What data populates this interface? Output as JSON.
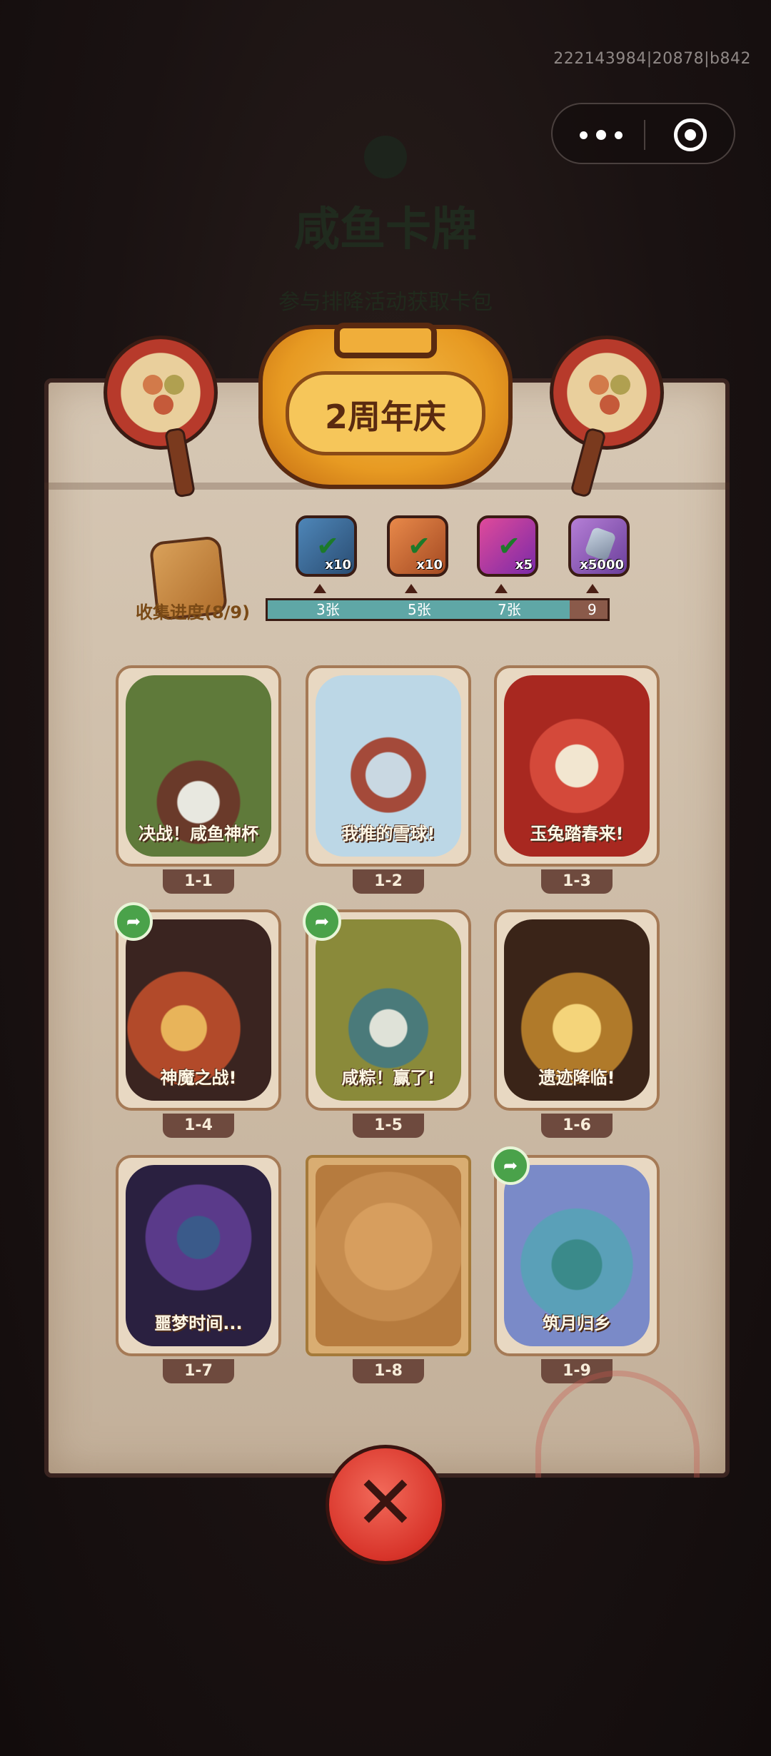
{
  "status_bar": {
    "user_id": "222143984|20878|b842"
  },
  "capsule": {
    "more_icon": "more-dots-icon",
    "close_icon": "target-circle-icon"
  },
  "background": {
    "title": "咸鱼卡牌",
    "subtitle": "参与排降活动获取卡包"
  },
  "banner": {
    "title": "2周年庆"
  },
  "progress": {
    "label": "收集进度(8/9)",
    "collected": 8,
    "total": 9,
    "milestones": [
      {
        "label": "3张",
        "count": 3,
        "reward_count": "x10",
        "icon": "blue-chest-check-icon",
        "claimed": true
      },
      {
        "label": "5张",
        "count": 5,
        "reward_count": "x10",
        "icon": "orange-key-check-icon",
        "claimed": true
      },
      {
        "label": "7张",
        "count": 7,
        "reward_count": "x5",
        "icon": "purple-orb-check-icon",
        "claimed": true
      },
      {
        "label": "9张",
        "count": 9,
        "reward_count": "x5000",
        "icon": "crystal-icon",
        "claimed": false
      }
    ]
  },
  "cards": [
    {
      "number": "1-1",
      "title": "决战！咸鱼神杯",
      "owned": true,
      "shareable": false
    },
    {
      "number": "1-2",
      "title": "我推的雪球!",
      "owned": true,
      "shareable": false
    },
    {
      "number": "1-3",
      "title": "玉兔踏春来!",
      "owned": true,
      "shareable": false
    },
    {
      "number": "1-4",
      "title": "神魔之战!",
      "owned": true,
      "shareable": true
    },
    {
      "number": "1-5",
      "title": "咸粽！赢了!",
      "owned": true,
      "shareable": true
    },
    {
      "number": "1-6",
      "title": "遗迹降临!",
      "owned": true,
      "shareable": false
    },
    {
      "number": "1-7",
      "title": "噩梦时间...",
      "owned": true,
      "shareable": false
    },
    {
      "number": "1-8",
      "title": "",
      "owned": false,
      "shareable": false
    },
    {
      "number": "1-9",
      "title": "筑月归乡",
      "owned": true,
      "shareable": true
    }
  ],
  "colors": {
    "progress_fill": "#5fa7a6",
    "progress_empty": "#8a5a4a",
    "share": "#4aa24a",
    "close": "#d8342a"
  }
}
